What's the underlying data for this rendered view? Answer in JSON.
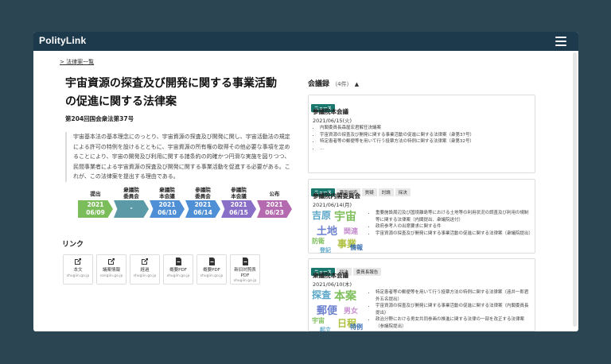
{
  "app": {
    "brand": "PolityLink"
  },
  "breadcrumb": "> 法律案一覧",
  "bill": {
    "title": "宇宙資源の探査及び開発に関する事業活動の促進に関する法律案",
    "number": "第204回国会衆法第37号",
    "summary": "宇宙基本法の基本理念にのっとり、宇宙資源の探査及び開発に関し、宇宙活動法の規定による許可の特例を設けるとともに、宇宙資源の所有権の取得その他必要な事項を定めることにより、宇宙の開発及び利用に関する諸条約の的確かつ円滑な実施を図りつつ、民間事業者による宇宙資源の探査及び開発に関する事業活動を促進する必要がある。これが、この法律案を提出する理由である。"
  },
  "timeline": [
    {
      "label": "提出",
      "date": "2021\n06/09",
      "color": "#7cbd5b"
    },
    {
      "label": "衆議院\n委員会",
      "date": "-",
      "color": "#5d9aa8"
    },
    {
      "label": "衆議院\n本会議",
      "date": "2021\n06/10",
      "color": "#4f8fd6"
    },
    {
      "label": "参議院\n委員会",
      "date": "2021\n06/14",
      "color": "#4f8fd6"
    },
    {
      "label": "参議院\n本会議",
      "date": "2021\n06/15",
      "color": "#8a6fc8"
    },
    {
      "label": "公布",
      "date": "2021\n06/23",
      "color": "#b56ab0"
    }
  ],
  "links": {
    "title": "リンク",
    "items": [
      {
        "name": "本文",
        "domain": "shugiin.go.jp",
        "icon": "external-link-icon"
      },
      {
        "name": "議案情報",
        "domain": "sangiin.go.jp",
        "icon": "external-link-icon"
      },
      {
        "name": "経過",
        "domain": "shugiin.go.jp",
        "icon": "external-link-icon"
      },
      {
        "name": "概要PDF",
        "domain": "shugiin.go.jp",
        "icon": "pdf-icon"
      },
      {
        "name": "概要PDF",
        "domain": "shugiin.go.jp",
        "icon": "pdf-icon"
      },
      {
        "name": "新旧対照表PDF",
        "domain": "shugiin.go.jp",
        "icon": "pdf-icon"
      }
    ]
  },
  "minutes": {
    "title": "会議録",
    "count": "（4件）",
    "cards": [
      {
        "tags": [
          "ニュース"
        ],
        "name": "参議院本会議",
        "date": "2021/06/15(火)",
        "bullets": [
          "内閣委員長森屋宏君解任決議案",
          "宇宙資源の探査及び開発に関する事業活動の促進に関する法律案（衆第37号）",
          "特定患者等の郵便等を用いて行う投票方法の特例に関する法律案（衆第32号）",
          "..."
        ]
      },
      {
        "tags": [
          "ニュース",
          "趣旨説明",
          "質疑",
          "討論",
          "採決"
        ],
        "name": "参議院内閣委員会",
        "date": "2021/06/14(月)",
        "bullets": [
          "重要施設周辺及び国境離島等における土地等の利用状況の調査及び利用の規制等に関する法律案（内閣提出、衆議院送付）",
          "政府参考人の出席要求に関する件",
          "宇宙資源の探査及び開発に関する事業活動の促進に関する法律案（衆議院提出）"
        ],
        "cloud": [
          "吉原",
          "宇宙",
          "土地",
          "関連",
          "防衛",
          "事業",
          "登記",
          "情報"
        ]
      },
      {
        "tags": [
          "ニュース",
          "採決",
          "委員長報告"
        ],
        "name": "衆議院本会議",
        "date": "2021/06/10(木)",
        "bullets": [
          "特定患者等の郵便等を用いて行う投票方法の特例に関する法律案（遠井一郎君外五名提出）",
          "宇宙資源の探査及び開発に関する事業活動の促進に関する法律案（内閣委員長提出）",
          "政治分野における男女共同参画の推進に関する法律の一部を改正する法律案（参議院提出）"
        ],
        "cloud": [
          "探査",
          "本案",
          "郵便",
          "男女",
          "宇宙",
          "日程",
          "起立",
          "特例"
        ]
      }
    ]
  },
  "colors": {
    "navbar": "#1d3a4d",
    "background": "#2c4552",
    "news_tag": "#19786e"
  }
}
